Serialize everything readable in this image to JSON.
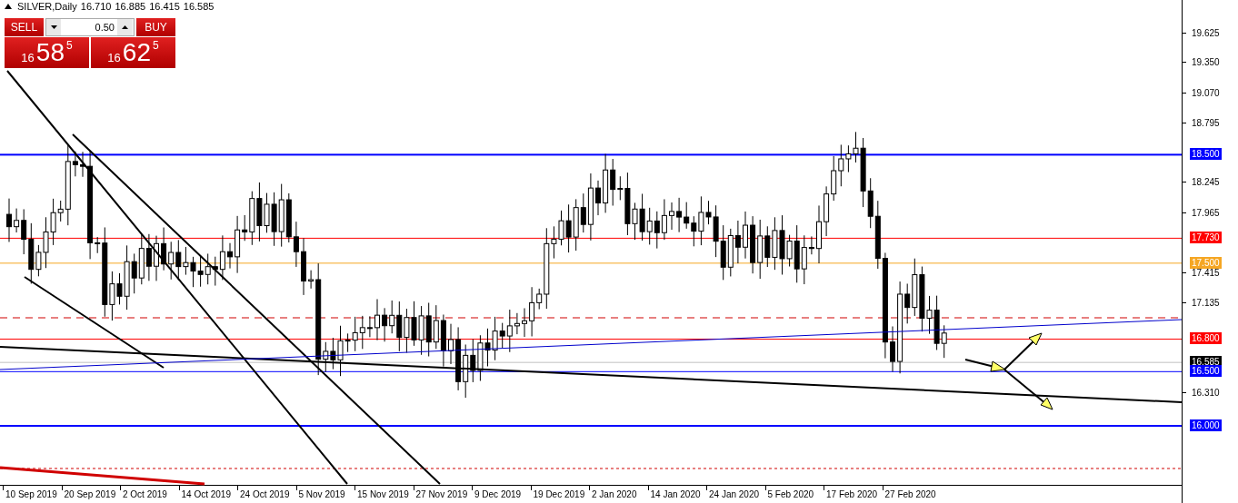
{
  "chart": {
    "symbol": "SILVER,Daily",
    "ohlc": [
      "16.710",
      "16.885",
      "16.415",
      "16.585"
    ]
  },
  "trade_panel": {
    "sell_label": "SELL",
    "buy_label": "BUY",
    "lot": "0.50",
    "bid": {
      "figure": "16",
      "pips": "58",
      "fraction": "5"
    },
    "ask": {
      "figure": "16",
      "pips": "62",
      "fraction": "5"
    }
  },
  "price_axis": {
    "ticks": [
      "19.625",
      "19.350",
      "19.070",
      "18.795",
      "18.245",
      "17.965",
      "17.415",
      "17.135",
      "16.310"
    ],
    "levels": [
      {
        "label": "18.500",
        "color": "#0000ff",
        "kind": "level",
        "thick": true
      },
      {
        "label": "17.730",
        "color": "#ff0000",
        "kind": "level",
        "thick": false
      },
      {
        "label": "17.500",
        "color": "#f5a623",
        "kind": "level",
        "thick": false
      },
      {
        "label": "16.800",
        "color": "#ff0000",
        "kind": "level",
        "thick": false
      },
      {
        "label": "16.585",
        "color": "#000000",
        "kind": "bid",
        "thick": false
      },
      {
        "label": "16.500",
        "color": "#0000ff",
        "kind": "level",
        "thick": false
      },
      {
        "label": "16.000",
        "color": "#0000ff",
        "kind": "level",
        "thick": true
      }
    ]
  },
  "date_axis": [
    "10 Sep 2019",
    "20 Sep 2019",
    "2 Oct 2019",
    "14 Oct 2019",
    "24 Oct 2019",
    "5 Nov 2019",
    "15 Nov 2019",
    "27 Nov 2019",
    "9 Dec 2019",
    "19 Dec 2019",
    "2 Jan 2020",
    "14 Jan 2020",
    "24 Jan 2020",
    "5 Feb 2020",
    "17 Feb 2020",
    "27 Feb 2020"
  ]
}
